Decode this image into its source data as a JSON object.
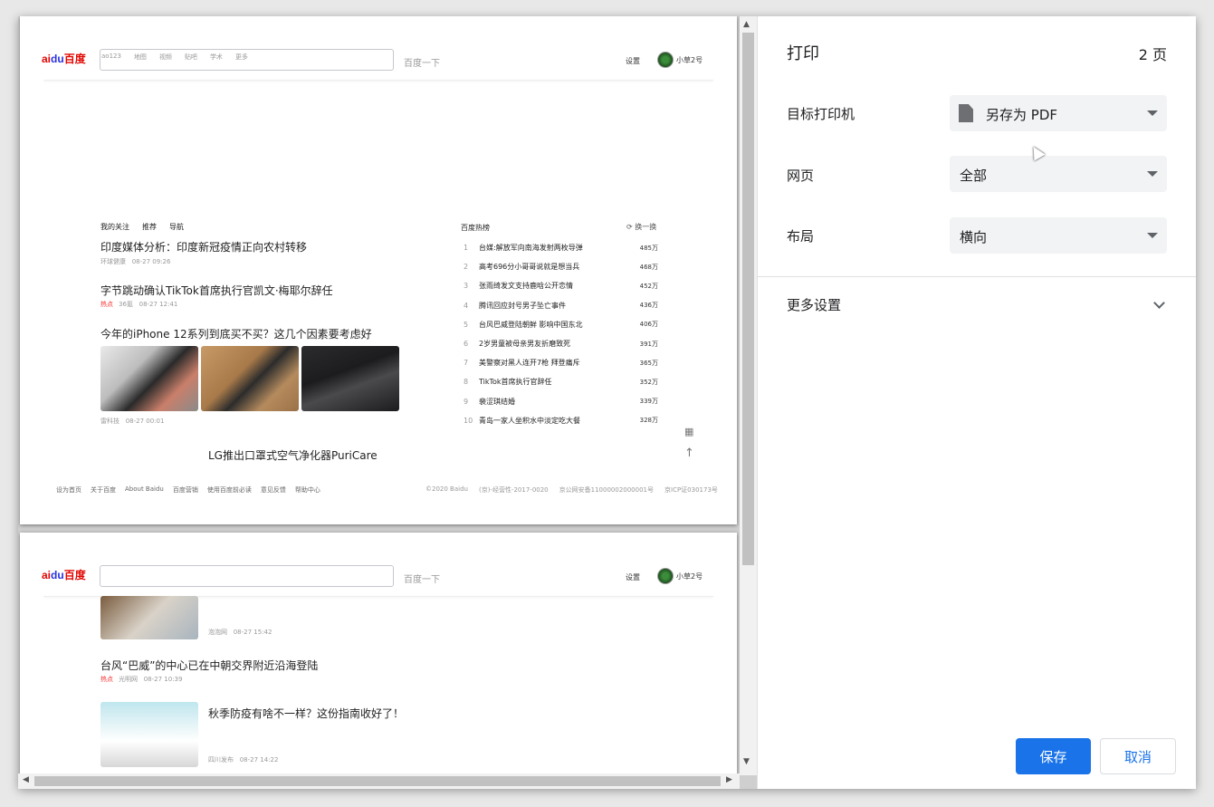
{
  "print_panel": {
    "title": "打印",
    "page_count": "2 页",
    "destination": {
      "label": "目标打印机",
      "value": "另存为 PDF"
    },
    "pages": {
      "label": "网页",
      "value": "全部"
    },
    "layout": {
      "label": "布局",
      "value": "横向"
    },
    "more_settings": "更多设置",
    "save_label": "保存",
    "cancel_label": "取消"
  },
  "preview": {
    "header": {
      "logo_text": "百度",
      "search_links": [
        "地图",
        "视频",
        "贴吧",
        "学术",
        "更多"
      ],
      "partial_text": "ao123",
      "search_button": "百度一下",
      "settings": "设置",
      "username": "小草2号"
    },
    "tabs": [
      "我的关注",
      "推荐",
      "导航"
    ],
    "news": [
      {
        "title": "印度媒体分析：印度新冠疫情正向农村转移",
        "source": "环球健康",
        "time": "08-27 09:26",
        "hot": ""
      },
      {
        "title": "字节跳动确认TikTok首席执行官凯文·梅耶尔辞任",
        "source": "36氪",
        "time": "08-27 12:41",
        "hot": "热点"
      },
      {
        "title": "今年的iPhone 12系列到底买不买？这几个因素要考虑好",
        "source": "雷科技",
        "time": "08-27 00:01",
        "hot": ""
      }
    ],
    "hot_list": {
      "title": "百度热榜",
      "refresh": "换一换",
      "items": [
        {
          "rank": "1",
          "text": "台媒:解放军向南海发射两枚导弹",
          "count": "485万"
        },
        {
          "rank": "2",
          "text": "高考696分小哥哥说就是想当兵",
          "count": "468万"
        },
        {
          "rank": "3",
          "text": "张雨绮发文支持鹿晗公开恋情",
          "count": "452万"
        },
        {
          "rank": "4",
          "text": "腾讯回应封号男子坠亡事件",
          "count": "436万"
        },
        {
          "rank": "5",
          "text": "台风巴威登陆朝鲜 影响中国东北",
          "count": "406万"
        },
        {
          "rank": "6",
          "text": "2岁男童被母亲男友折磨致死",
          "count": "391万"
        },
        {
          "rank": "7",
          "text": "美警察对黑人连开7枪 拜登痛斥",
          "count": "365万"
        },
        {
          "rank": "8",
          "text": "TikTok首席执行官辞任",
          "count": "352万"
        },
        {
          "rank": "9",
          "text": "裴涩琪结婚",
          "count": "339万"
        },
        {
          "rank": "10",
          "text": "青岛一家人坐积水中淡定吃大餐",
          "count": "328万"
        }
      ]
    },
    "center_title": "LG推出口罩式空气净化器PuriCare",
    "footer_left": [
      "设为首页",
      "关于百度",
      "About Baidu",
      "百度营销",
      "使用百度前必读",
      "意见反馈",
      "帮助中心"
    ],
    "footer_right": [
      "©2020 Baidu",
      "(京)-经营性-2017-0020",
      "京公网安备11000002000001号",
      "京ICP证030173号"
    ],
    "page2_news": [
      {
        "source": "泡泡网",
        "time": "08-27 15:42"
      },
      {
        "title": "台风“巴威”的中心已在中朝交界附近沿海登陆",
        "hot": "热点",
        "source": "光明网",
        "time": "08-27 10:39"
      },
      {
        "title": "秋季防疫有啥不一样？这份指南收好了！",
        "source": "四川发布",
        "time": "08-27 14:22"
      }
    ]
  }
}
